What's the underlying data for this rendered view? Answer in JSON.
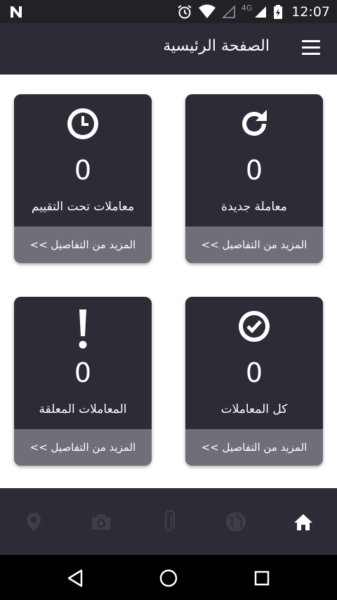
{
  "status_bar": {
    "time": "12:07",
    "network_type": "4G",
    "icons": [
      "notification-n-icon",
      "alarm-icon",
      "wifi-icon",
      "signal-empty-icon",
      "signal-icon",
      "battery-charging-icon"
    ]
  },
  "header": {
    "title": "الصفحة الرئيسية",
    "menu_icon": "hamburger-menu-icon"
  },
  "cards": [
    {
      "icon": "refresh-icon",
      "count": "0",
      "label": "معاملة جديدة",
      "footer": "المزيد من التفاصيل >>"
    },
    {
      "icon": "clock-icon",
      "count": "0",
      "label": "معاملات تحت التقييم",
      "footer": "المزيد من التفاصيل >>"
    },
    {
      "icon": "check-circle-icon",
      "count": "0",
      "label": "كل المعاملات",
      "footer": "المزيد من التفاصيل >>"
    },
    {
      "icon": "exclamation-icon",
      "count": "0",
      "label": "المعاملات المعلقة",
      "footer": "المزيد من التفاصيل >>"
    }
  ],
  "bottom_nav": {
    "items": [
      "home-icon",
      "globe-icon",
      "attachment-icon",
      "camera-icon",
      "location-pin-icon"
    ],
    "active": "home-icon"
  },
  "system_nav": [
    "back-icon",
    "home-circle-icon",
    "recents-icon"
  ],
  "colors": {
    "status_bar": "#212126",
    "app_bar": "#2b2c35",
    "card": "#2b2c35",
    "card_footer": "#6e6f78",
    "nav_inactive": "#3d3e48",
    "nav_active": "#ffffff"
  }
}
